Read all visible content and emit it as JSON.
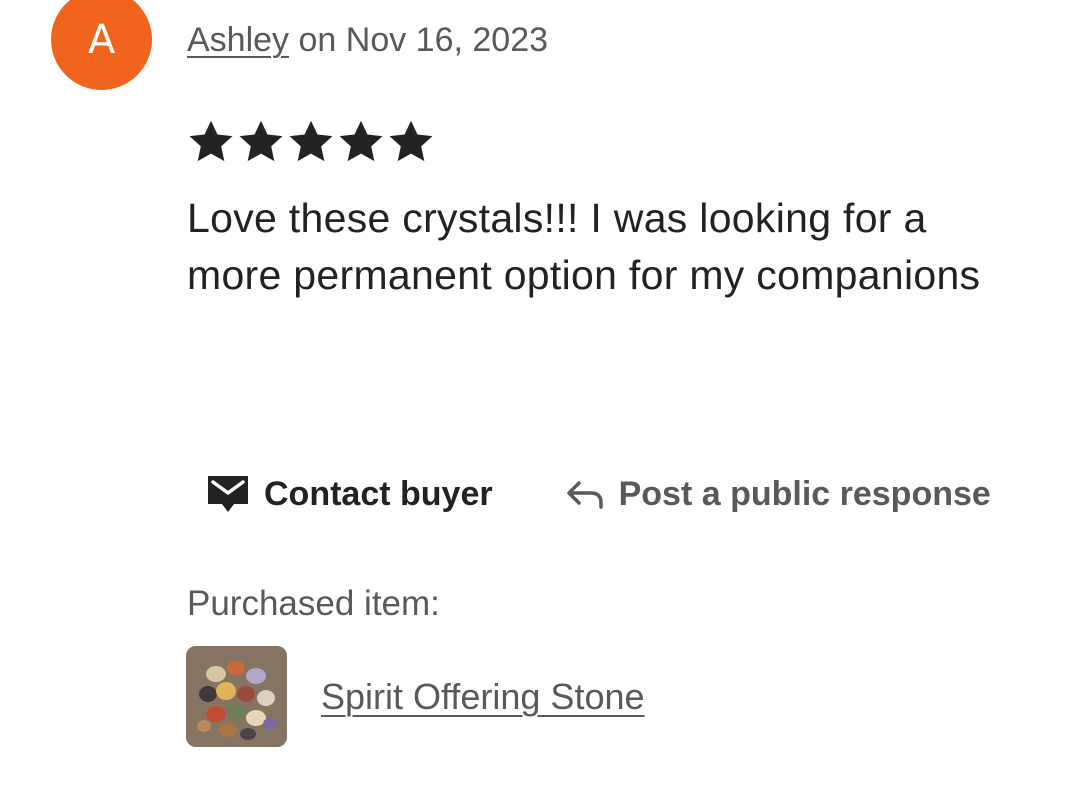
{
  "review": {
    "avatar_initial": "A",
    "author": "Ashley",
    "date_text": " on Nov 16, 2023",
    "rating": 5,
    "rating_max": 5,
    "text": "Love these crystals!!! I was looking for a more permanent option for my companions"
  },
  "actions": {
    "contact_label": "Contact buyer",
    "contact_icon": "message-envelope-icon",
    "respond_label": "Post a public response",
    "respond_icon": "reply-arrow-icon"
  },
  "purchased": {
    "label": "Purchased item:",
    "item_name": "Spirit Offering Stone",
    "thumbnail_icon": "tumbled-stones-thumbnail"
  },
  "colors": {
    "avatar_bg": "#f1641e",
    "text_primary": "#222222",
    "text_secondary": "#595959"
  }
}
